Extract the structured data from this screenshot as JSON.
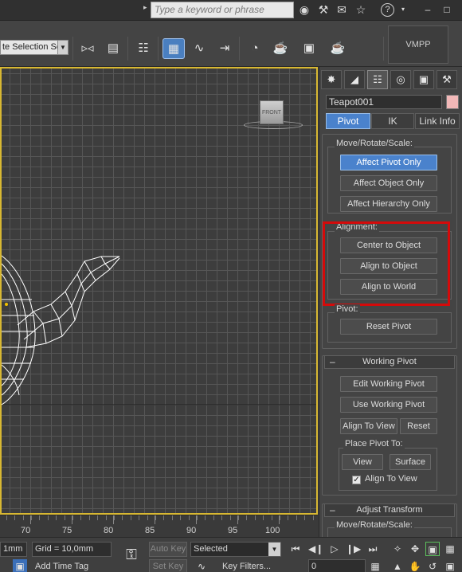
{
  "titlebar": {
    "search_placeholder": "Type a keyword or phrase",
    "icons": [
      "binoculars-icon",
      "wrench-icon",
      "bell-icon",
      "star-icon",
      "help-icon"
    ],
    "help_symbol": "?",
    "minimize": "–",
    "restore": "□"
  },
  "toolbar": {
    "selection_set": "te Selection Se",
    "vmpp_label": "VMPP"
  },
  "viewport": {
    "viewcube_label": "FRONT"
  },
  "timeslider": {
    "ticks": [
      "70",
      "75",
      "80",
      "85",
      "90",
      "95",
      "100"
    ]
  },
  "statusbar": {
    "unit_field": "1mm",
    "grid": "Grid = 10,0mm",
    "auto_key": "Auto Key",
    "set_key": "Set Key",
    "key_mode": "Selected",
    "key_filters": "Key Filters...",
    "add_time_tag": "Add Time Tag",
    "frame": "0"
  },
  "cmdpanel": {
    "tabs": [
      "create-icon",
      "modify-icon",
      "hierarchy-icon",
      "motion-icon",
      "display-icon",
      "utilities-icon"
    ],
    "object_name": "Teapot001",
    "object_color": "#f2b8b8",
    "subtabs": {
      "pivot": "Pivot",
      "ik": "IK",
      "link_info": "Link Info"
    },
    "move_rotate_scale": {
      "label": "Move/Rotate/Scale:",
      "affect_pivot_only": "Affect Pivot Only",
      "affect_object_only": "Affect Object Only",
      "affect_hierarchy_only": "Affect Hierarchy Only"
    },
    "alignment": {
      "label": "Alignment:",
      "center_to_object": "Center to Object",
      "align_to_object": "Align to Object",
      "align_to_world": "Align to World"
    },
    "pivot": {
      "label": "Pivot:",
      "reset_pivot": "Reset Pivot"
    },
    "working_pivot": {
      "header": "Working Pivot",
      "sign": "–",
      "edit_working_pivot": "Edit Working Pivot",
      "use_working_pivot": "Use Working Pivot",
      "align_to_view": "Align To View",
      "reset": "Reset",
      "place_pivot_to": {
        "label": "Place Pivot To:",
        "view": "View",
        "surface": "Surface",
        "align_to_view_checkbox": "Align To View",
        "checked": true
      }
    },
    "adjust_transform": {
      "header": "Adjust Transform",
      "sign": "–",
      "move_rotate_scale_label": "Move/Rotate/Scale:"
    }
  },
  "colors": {
    "accent_blue": "#4a82cc",
    "highlight_red": "#d40a0a",
    "viewport_border": "#d8b832"
  }
}
